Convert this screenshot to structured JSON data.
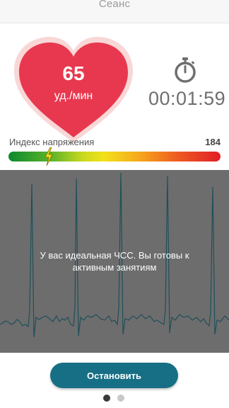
{
  "header": {
    "title": "Сеанс"
  },
  "heart_rate": {
    "value": "65",
    "unit": "уд./мин"
  },
  "timer": {
    "icon": "stopwatch-icon",
    "elapsed": "00:01:59"
  },
  "stress_index": {
    "label": "Индекс напряжения",
    "value": "184",
    "marker_icon": "lightning-bolt-icon",
    "level_fraction": 0.19
  },
  "ecg": {
    "message": "У вас идеальная ЧСС. Вы готовы к активным занятиям"
  },
  "actions": {
    "stop_label": "Остановить"
  },
  "pager": {
    "count": 2,
    "active_index": 0
  },
  "colors": {
    "heart": "#e8384f",
    "heart_glow": "#f6c6c6",
    "button": "#176f85",
    "ecg_background": "#6d6d6d",
    "ecg_line": "#1f4f5a"
  }
}
